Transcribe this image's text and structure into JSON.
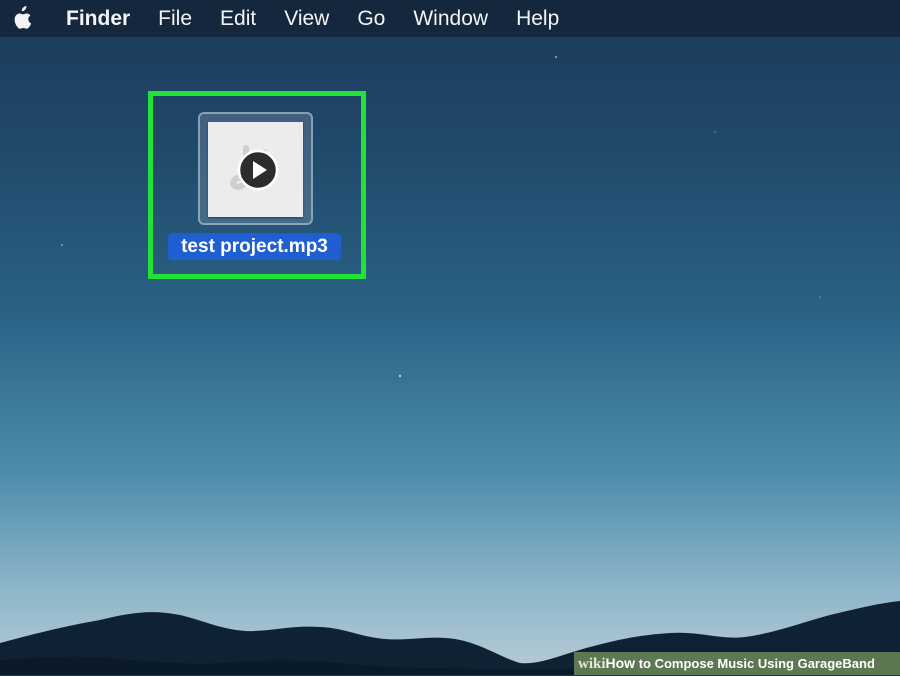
{
  "menubar": {
    "apple_icon": "apple-logo-icon",
    "app_name": "Finder",
    "items": [
      "File",
      "Edit",
      "View",
      "Go",
      "Window",
      "Help"
    ]
  },
  "desktop": {
    "file": {
      "name": "test project.mp3",
      "icon": "audio-file-play-icon",
      "selected": true
    }
  },
  "watermark": {
    "brand_prefix": "wiki",
    "brand_how": "How",
    "title": " to Compose Music Using GarageBand"
  },
  "colors": {
    "highlight_box": "#22e335",
    "selection": "#1f5fd1",
    "menubar": "#15273c"
  }
}
